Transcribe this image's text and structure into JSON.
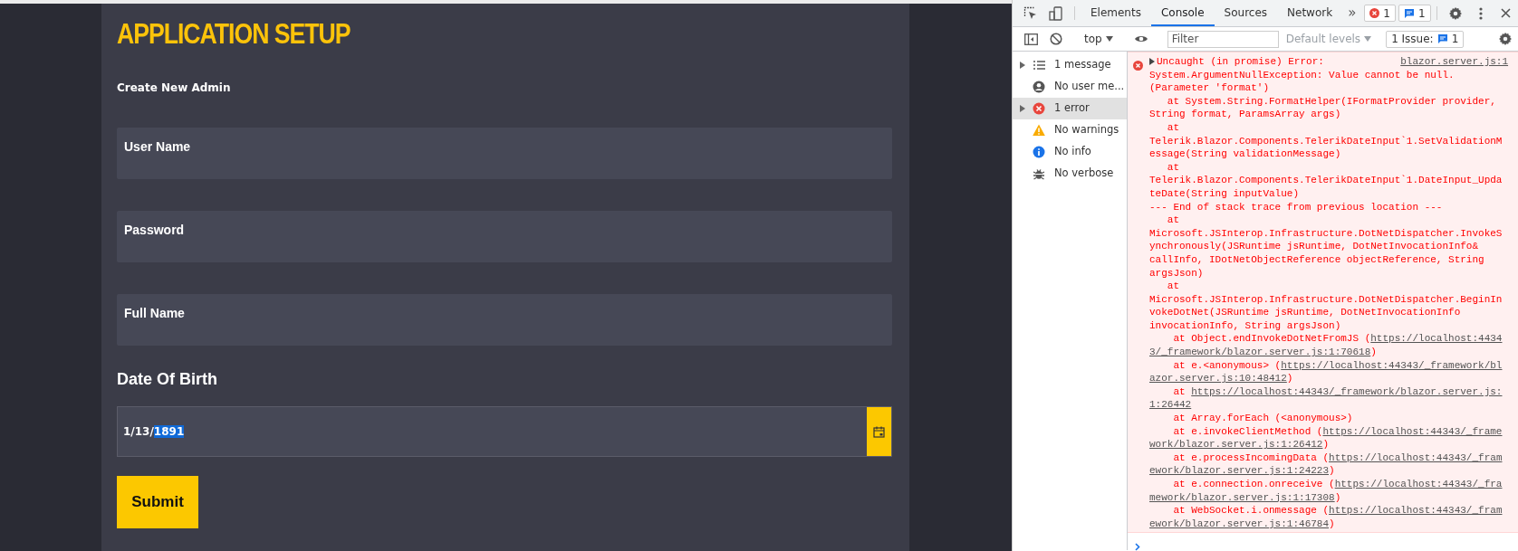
{
  "page": {
    "title": "APPLICATION SETUP",
    "subtitle": "Create New Admin",
    "fields": [
      {
        "label": "User Name"
      },
      {
        "label": "Password"
      },
      {
        "label": "Full Name"
      }
    ],
    "date_label": "Date Of Birth",
    "date_field": {
      "value_parts": [
        {
          "text": "1/13/",
          "selected": false
        },
        {
          "text": "1891",
          "selected": true
        }
      ]
    },
    "submit": "Submit"
  },
  "devtools": {
    "tabs": [
      {
        "label": "Elements",
        "selected": false
      },
      {
        "label": "Console",
        "selected": true
      },
      {
        "label": "Sources",
        "selected": false
      },
      {
        "label": "Network",
        "selected": false
      }
    ],
    "more": "»",
    "error_count": "1",
    "message_count": "1",
    "context": "top",
    "filter_placeholder": "Filter",
    "levels": "Default levels",
    "issues_label": "1 Issue:",
    "issues_count": "1",
    "sidebar": [
      {
        "label": "1 message",
        "kind": "message",
        "expandable": true,
        "selected": false
      },
      {
        "label": "No user me...",
        "kind": "user",
        "expandable": false,
        "selected": false
      },
      {
        "label": "1 error",
        "kind": "error",
        "expandable": true,
        "selected": true
      },
      {
        "label": "No warnings",
        "kind": "warning",
        "expandable": false,
        "selected": false
      },
      {
        "label": "No info",
        "kind": "info",
        "expandable": false,
        "selected": false
      },
      {
        "label": "No verbose",
        "kind": "verbose",
        "expandable": false,
        "selected": false
      }
    ],
    "messages": [
      {
        "kind": "error",
        "source": "blazor.server.js:1",
        "lines": [
          {
            "text": "Uncaught (in promise) Error:"
          },
          {
            "text": "System.ArgumentNullException: Value cannot be null."
          },
          {
            "text": "(Parameter 'format')"
          },
          {
            "text": "   at System.String.FormatHelper(IFormatProvider provider,"
          },
          {
            "text": "String format, ParamsArray args)"
          },
          {
            "text": "   at"
          },
          {
            "text": "Telerik.Blazor.Components.TelerikDateInput`1.SetValidationM"
          },
          {
            "text": "essage(String validationMessage)"
          },
          {
            "text": "   at"
          },
          {
            "text": "Telerik.Blazor.Components.TelerikDateInput`1.DateInput_Upda"
          },
          {
            "text": "teDate(String inputValue)"
          },
          {
            "text": "--- End of stack trace from previous location ---"
          },
          {
            "text": "   at"
          },
          {
            "text": "Microsoft.JSInterop.Infrastructure.DotNetDispatcher.InvokeS"
          },
          {
            "text": "ynchronously(JSRuntime jsRuntime, DotNetInvocationInfo&"
          },
          {
            "text": "callInfo, IDotNetObjectReference objectReference, String"
          },
          {
            "text": "argsJson)"
          },
          {
            "text": "   at"
          },
          {
            "text": "Microsoft.JSInterop.Infrastructure.DotNetDispatcher.BeginIn"
          },
          {
            "text": "vokeDotNet(JSRuntime jsRuntime, DotNetInvocationInfo"
          },
          {
            "text": "invocationInfo, String argsJson)"
          },
          {
            "text": "    at Object.endInvokeDotNetFromJS (",
            "link": "https://localhost:4434"
          },
          {
            "link": "3/_framework/blazor.server.js:1:70618",
            "tail": ")"
          },
          {
            "text": "    at e.<anonymous> (",
            "link": "https://localhost:44343/_framework/bl"
          },
          {
            "link": "azor.server.js:10:48412",
            "tail": ")"
          },
          {
            "text": "    at ",
            "link": "https://localhost:44343/_framework/blazor.server.js:"
          },
          {
            "link": "1:26442"
          },
          {
            "text": "    at Array.forEach (<anonymous>)"
          },
          {
            "text": "    at e.invokeClientMethod (",
            "link": "https://localhost:44343/_frame"
          },
          {
            "link": "work/blazor.server.js:1:26412",
            "tail": ")"
          },
          {
            "text": "    at e.processIncomingData (",
            "link": "https://localhost:44343/_fram"
          },
          {
            "link": "ework/blazor.server.js:1:24223",
            "tail": ")"
          },
          {
            "text": "    at e.connection.onreceive (",
            "link": "https://localhost:44343/_fra"
          },
          {
            "link": "mework/blazor.server.js:1:17308",
            "tail": ")"
          },
          {
            "text": "    at WebSocket.i.onmessage (",
            "link": "https://localhost:44343/_fram"
          },
          {
            "link": "ework/blazor.server.js:1:46784",
            "tail": ")"
          }
        ]
      }
    ]
  }
}
